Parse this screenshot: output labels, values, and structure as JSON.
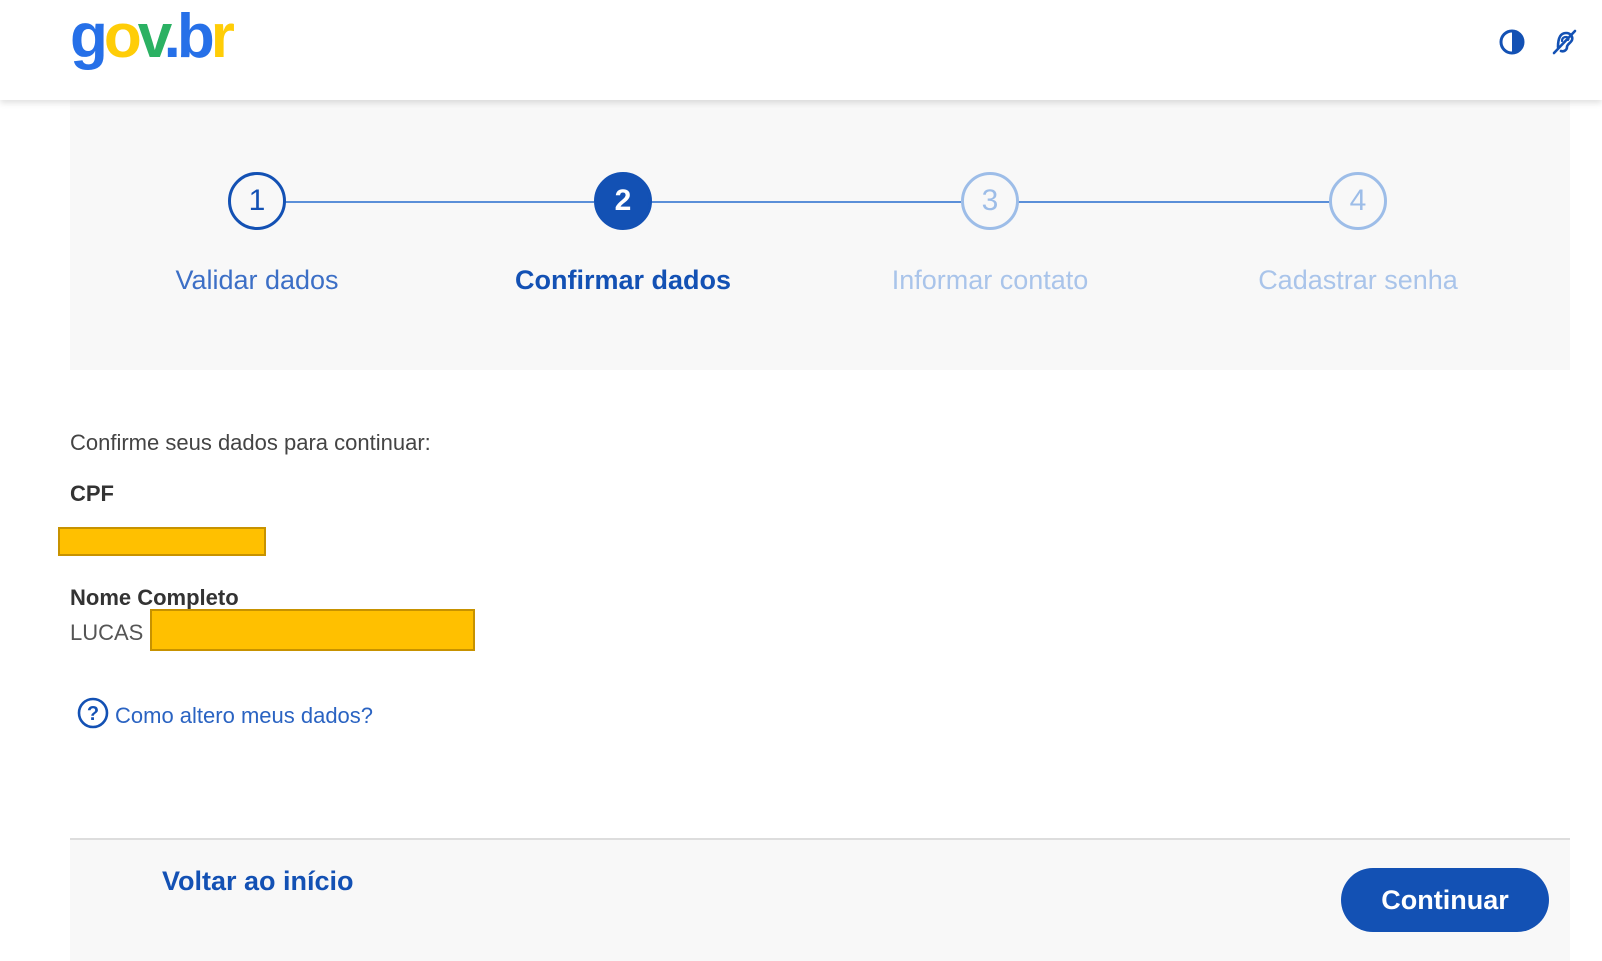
{
  "header": {
    "logo": {
      "g": "g",
      "o": "o",
      "v": "v",
      "dot": ".",
      "b": "b",
      "r": "r"
    },
    "icons": [
      "contrast-icon",
      "accessibility-icon"
    ]
  },
  "stepper": {
    "steps": [
      {
        "number": "1",
        "label": "Validar dados",
        "state": "done"
      },
      {
        "number": "2",
        "label": "Confirmar dados",
        "state": "active"
      },
      {
        "number": "3",
        "label": "Informar contato",
        "state": "pending"
      },
      {
        "number": "4",
        "label": "Cadastrar senha",
        "state": "pending"
      }
    ]
  },
  "content": {
    "intro": "Confirme seus dados para continuar:",
    "cpf_label": "CPF",
    "name_label": "Nome Completo",
    "name_value": "LUCAS",
    "help_link": "Como altero meus dados?"
  },
  "footer": {
    "back_label": "Voltar ao início",
    "continue_label": "Continuar"
  },
  "colors": {
    "primary": "#1351b4",
    "redaction": "#ffc000",
    "panel": "#f8f8f8"
  }
}
